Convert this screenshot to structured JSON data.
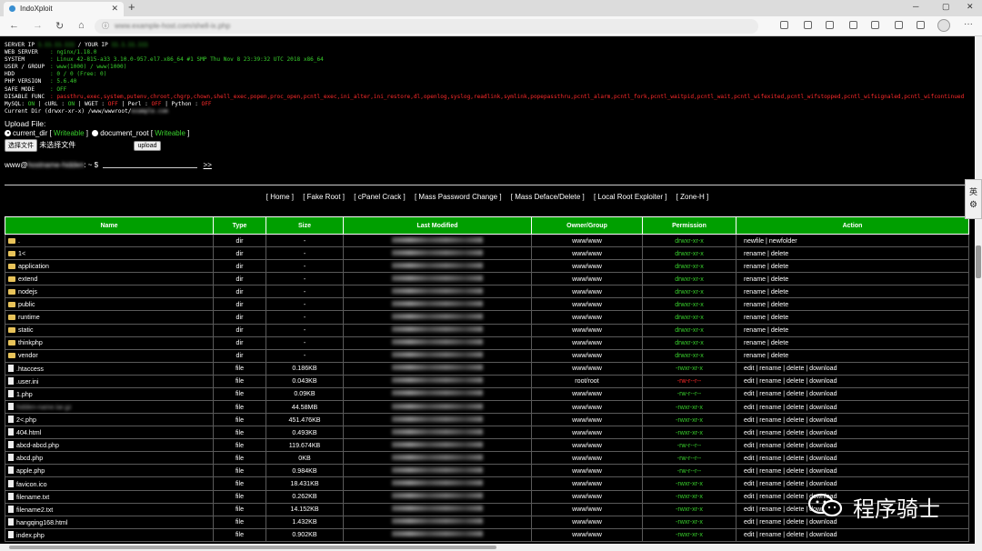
{
  "browser": {
    "tab_title": "IndoXploit",
    "tab_close": "✕",
    "new_tab": "+",
    "win_min": "─",
    "win_max": "▢",
    "win_close": "✕",
    "back": "←",
    "forward": "→",
    "reload": "↻",
    "home": "⌂",
    "lock": "ⓘ",
    "url": "www.example-host.com/shell-ix.php",
    "menu": "···"
  },
  "server_info": {
    "server_ip_label": "SERVER IP",
    "your_ip_label": "/ YOUR IP",
    "server_ip": "1.11.11.111",
    "your_ip": "11.1.11.111",
    "web_server_label": "WEB SERVER",
    "web_server": ": nginx/1.18.0",
    "system_label": "SYSTEM",
    "system": ": Linux 42-815-a33 3.10.0-957.el7.x86_64 #1 SMP Thu Nov 8 23:39:32 UTC 2018 x86_64",
    "user_group_label": "USER / GROUP",
    "user_group": ": www(1000) / www(1000)",
    "hdd_label": "HDD",
    "hdd": ": 0 / 0 (Free: 0)",
    "php_version_label": "PHP VERSION",
    "php_version": ": 5.6.40",
    "safe_mode_label": "SAFE MODE",
    "safe_mode": ": OFF",
    "disable_func_label": "DISABLE FUNC",
    "disable_func": ": passthru,exec,system,putenv,chroot,chgrp,chown,shell_exec,popen,proc_open,pcntl_exec,ini_alter,ini_restore,dl,openlog,syslog,readlink,symlink,popepassthru,pcntl_alarm,pcntl_fork,pcntl_waitpid,pcntl_wait,pcntl_wifexited,pcntl_wifstopped,pcntl_wifsignaled,pcntl_wifcontinued",
    "mysql_label": "MySQL:",
    "mysql": "ON",
    "curl_label": "| cURL :",
    "curl": "ON",
    "wget_label": "| WGET :",
    "wget": "OFF",
    "perl_label": "| Perl :",
    "perl": "OFF",
    "python_label": "| Python :",
    "python": "OFF",
    "current_dir_label": "Current Dir (drwxr-xr-x) /www/wwwroot/",
    "current_dir_hidden": "example.com"
  },
  "upload": {
    "title": "Upload File:",
    "opt_current": "current_dir",
    "opt_document": "document_root",
    "writeable": "Writeable",
    "choose_button": "选择文件",
    "no_file": "未选择文件",
    "upload_button": "upload"
  },
  "shell": {
    "prompt_user": "www@",
    "prompt_host": "hostname-hidden",
    "prompt_tail": ": ~ $",
    "go": ">>"
  },
  "menu": [
    "[ Home ]",
    "[ Fake Root ]",
    "[ cPanel Crack ]",
    "[ Mass Password Change ]",
    "[ Mass Deface/Delete ]",
    "[ Local Root Exploiter ]",
    "[ Zone-H ]"
  ],
  "table": {
    "headers": [
      "Name",
      "Type",
      "Size",
      "Last Modified",
      "Owner/Group",
      "Permission",
      "Action"
    ],
    "rows": [
      {
        "name": ".",
        "type": "dir",
        "size": "-",
        "owner": "www/www",
        "perm": "drwxr-xr-x",
        "perm_color": "green",
        "action": "newfile | newfolder",
        "icon": "folder"
      },
      {
        "name": "1<",
        "type": "dir",
        "size": "-",
        "owner": "www/www",
        "perm": "drwxr-xr-x",
        "perm_color": "green",
        "action": "rename | delete",
        "icon": "folder"
      },
      {
        "name": "application",
        "type": "dir",
        "size": "-",
        "owner": "www/www",
        "perm": "drwxr-xr-x",
        "perm_color": "green",
        "action": "rename | delete",
        "icon": "folder"
      },
      {
        "name": "extend",
        "type": "dir",
        "size": "-",
        "owner": "www/www",
        "perm": "drwxr-xr-x",
        "perm_color": "green",
        "action": "rename | delete",
        "icon": "folder"
      },
      {
        "name": "nodejs",
        "type": "dir",
        "size": "-",
        "owner": "www/www",
        "perm": "drwxr-xr-x",
        "perm_color": "green",
        "action": "rename | delete",
        "icon": "folder"
      },
      {
        "name": "public",
        "type": "dir",
        "size": "-",
        "owner": "www/www",
        "perm": "drwxr-xr-x",
        "perm_color": "green",
        "action": "rename | delete",
        "icon": "folder"
      },
      {
        "name": "runtime",
        "type": "dir",
        "size": "-",
        "owner": "www/www",
        "perm": "drwxr-xr-x",
        "perm_color": "green",
        "action": "rename | delete",
        "icon": "folder"
      },
      {
        "name": "static",
        "type": "dir",
        "size": "-",
        "owner": "www/www",
        "perm": "drwxr-xr-x",
        "perm_color": "green",
        "action": "rename | delete",
        "icon": "folder"
      },
      {
        "name": "thinkphp",
        "type": "dir",
        "size": "-",
        "owner": "www/www",
        "perm": "drwxr-xr-x",
        "perm_color": "green",
        "action": "rename | delete",
        "icon": "folder"
      },
      {
        "name": "vendor",
        "type": "dir",
        "size": "-",
        "owner": "www/www",
        "perm": "drwxr-xr-x",
        "perm_color": "green",
        "action": "rename | delete",
        "icon": "folder"
      },
      {
        "name": ".htaccess",
        "type": "file",
        "size": "0.186KB",
        "owner": "www/www",
        "perm": "-rwxr-xr-x",
        "perm_color": "green",
        "action": "edit | rename | delete | download",
        "icon": "file"
      },
      {
        "name": ".user.ini",
        "type": "file",
        "size": "0.043KB",
        "owner": "root/root",
        "perm": "-rw-r--r--",
        "perm_color": "red",
        "action": "edit | rename | delete | download",
        "icon": "file"
      },
      {
        "name": "1.php",
        "type": "file",
        "size": "0.09KB",
        "owner": "www/www",
        "perm": "-rw-r--r--",
        "perm_color": "green",
        "action": "edit | rename | delete | download",
        "icon": "file"
      },
      {
        "name": "hidden-name.tar.gz",
        "type": "file",
        "size": "44.58MB",
        "owner": "www/www",
        "perm": "-rwxr-xr-x",
        "perm_color": "green",
        "action": "edit | rename | delete | download",
        "icon": "file",
        "blurred": true
      },
      {
        "name": "2<.php",
        "type": "file",
        "size": "451.476KB",
        "owner": "www/www",
        "perm": "-rwxr-xr-x",
        "perm_color": "green",
        "action": "edit | rename | delete | download",
        "icon": "file"
      },
      {
        "name": "404.html",
        "type": "file",
        "size": "0.493KB",
        "owner": "www/www",
        "perm": "-rwxr-xr-x",
        "perm_color": "green",
        "action": "edit | rename | delete | download",
        "icon": "file"
      },
      {
        "name": "abcd-abcd.php",
        "type": "file",
        "size": "119.674KB",
        "owner": "www/www",
        "perm": "-rw-r--r--",
        "perm_color": "green",
        "action": "edit | rename | delete | download",
        "icon": "file"
      },
      {
        "name": "abcd.php",
        "type": "file",
        "size": "0KB",
        "owner": "www/www",
        "perm": "-rw-r--r--",
        "perm_color": "green",
        "action": "edit | rename | delete | download",
        "icon": "file"
      },
      {
        "name": "apple.php",
        "type": "file",
        "size": "0.984KB",
        "owner": "www/www",
        "perm": "-rw-r--r--",
        "perm_color": "green",
        "action": "edit | rename | delete | download",
        "icon": "file"
      },
      {
        "name": "favicon.ico",
        "type": "file",
        "size": "18.431KB",
        "owner": "www/www",
        "perm": "-rwxr-xr-x",
        "perm_color": "green",
        "action": "edit | rename | delete | download",
        "icon": "file"
      },
      {
        "name": "filename.txt",
        "type": "file",
        "size": "0.262KB",
        "owner": "www/www",
        "perm": "-rwxr-xr-x",
        "perm_color": "green",
        "action": "edit | rename | delete | download",
        "icon": "file"
      },
      {
        "name": "filename2.txt",
        "type": "file",
        "size": "14.152KB",
        "owner": "www/www",
        "perm": "-rwxr-xr-x",
        "perm_color": "green",
        "action": "edit | rename | delete | download",
        "icon": "file"
      },
      {
        "name": "hangqing168.html",
        "type": "file",
        "size": "1.432KB",
        "owner": "www/www",
        "perm": "-rwxr-xr-x",
        "perm_color": "green",
        "action": "edit | rename | delete | download",
        "icon": "file"
      },
      {
        "name": "index.php",
        "type": "file",
        "size": "0.902KB",
        "owner": "www/www",
        "perm": "-rwxr-xr-x",
        "perm_color": "green",
        "action": "edit | rename | delete | download",
        "icon": "file"
      }
    ]
  },
  "side": {
    "ime_label": "英",
    "ime_gear": "⚙"
  },
  "watermark": {
    "text": "程序骑士"
  }
}
